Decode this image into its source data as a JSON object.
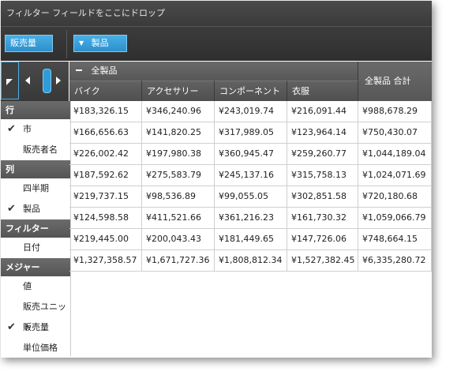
{
  "filter_bar": {
    "label": "フィルター フィールドをここにドロップ"
  },
  "drop_area": {
    "measure_chip": "販売量",
    "column_chip": "製品"
  },
  "panel": {
    "sections": [
      {
        "title": "行",
        "items": [
          {
            "label": "市",
            "checked": true
          },
          {
            "label": "販売者名",
            "checked": false
          }
        ]
      },
      {
        "title": "列",
        "items": [
          {
            "label": "四半期",
            "checked": false
          },
          {
            "label": "製品",
            "checked": true
          }
        ]
      },
      {
        "title": "フィルター",
        "items": [
          {
            "label": "日付",
            "checked": false
          }
        ]
      },
      {
        "title": "メジャー",
        "items": [
          {
            "label": "値",
            "checked": false
          },
          {
            "label": "販売ユニット",
            "checked": false
          },
          {
            "label": "販売量",
            "checked": true
          },
          {
            "label": "単位価格",
            "checked": false
          }
        ]
      }
    ]
  },
  "grid": {
    "group_header": "全製品",
    "total_header": "全製品 合計",
    "columns": [
      "バイク",
      "アクセサリー",
      "コンポーネント",
      "衣服"
    ],
    "rows": [
      [
        "¥183,326.15",
        "¥346,240.96",
        "¥243,019.74",
        "¥216,091.44",
        "¥988,678.29"
      ],
      [
        "¥166,656.63",
        "¥141,820.25",
        "¥317,989.05",
        "¥123,964.14",
        "¥750,430.07"
      ],
      [
        "¥226,002.42",
        "¥197,980.38",
        "¥360,945.47",
        "¥259,260.77",
        "¥1,044,189.04"
      ],
      [
        "¥187,592.62",
        "¥275,583.79",
        "¥245,137.16",
        "¥315,758.13",
        "¥1,024,071.69"
      ],
      [
        "¥219,737.15",
        "¥98,536.89",
        "¥99,055.05",
        "¥302,851.58",
        "¥720,180.68"
      ],
      [
        "¥124,598.58",
        "¥411,521.66",
        "¥361,216.23",
        "¥161,730.32",
        "¥1,059,066.79"
      ],
      [
        "¥219,445.00",
        "¥200,043.43",
        "¥181,449.65",
        "¥147,726.06",
        "¥748,664.15"
      ],
      [
        "¥1,327,358.57",
        "¥1,671,727.36",
        "¥1,808,812.34",
        "¥1,527,382.45",
        "¥6,335,280.72"
      ]
    ]
  },
  "colors": {
    "accent": "#2d8fcc",
    "header_dark": "#3a3a3a",
    "section": "#5d5d5d"
  }
}
